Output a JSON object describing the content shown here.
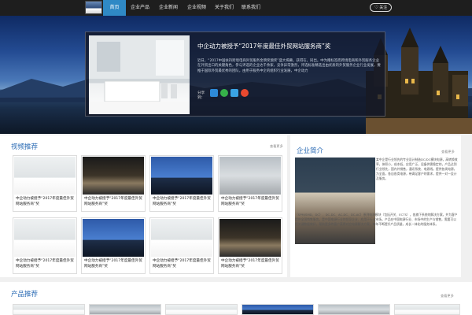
{
  "nav": {
    "items": [
      "首页",
      "企业产品",
      "企业新闻",
      "企业视频",
      "关于我们",
      "联系我们"
    ],
    "active_index": 0,
    "follow_label": "关注"
  },
  "hero": {
    "title": "中企动力被授予“2017年度最佳外贸网站服务商”奖",
    "text": "近日，“2017中国扶持跨境电商外贸服务金牌奖颁奖”盛大揭幕，获得在，同出。中为赠标签而跨境电商和外贸服务企业在外贸出口的关键角色，参与评选的企业达千余家，竞争异常激烈，评选标准精选出由优质的外贸服务企业行业发展，要推于国际外贸最优秀的团队，由用于服务中企的组织行业发展，中企动力",
    "share_label": "分享到："
  },
  "video": {
    "title": "视频推荐",
    "more": "查看更多",
    "items": [
      "中企动力被授予“2017年度最佳外贸网站服务商”奖",
      "中企动力被授予“2017年度最佳外贸网站服务商”奖",
      "中企动力被授予“2017年度最佳外贸网站服务商”奖",
      "中企动力被授予“2017年度最佳外贸网站服务商”奖",
      "中企动力被授予“2017年度最佳外贸网站服务商”奖",
      "中企动力被授予“2017年度最佳外贸网站服务商”奖",
      "中企动力被授予“2017年度最佳外贸网站服务商”奖",
      "中企动力被授予“2017年度最佳外贸网站服务商”奖"
    ]
  },
  "intro": {
    "title": "企业简介",
    "more": "查看更多",
    "text1": "某中企是行业领先的专业设计制造DC/DC模块电源，高转换效率，体积小，成本低，应用广泛，设备供需稳定的，产品达到行业领先，国内外销售，通讯系统、电源线。提供各类电源，为全面，各自各类电源，带满足客户的需求，提供一对一设计及服务。",
    "text2": "（SPM/SMD、DC）、DC-DC、AC-DC、DC-AC）系列电源模块（包括开关、ECTS），各旗下系统的解决方案，并为客户提供全国销售服务，是中国电源行业的领导企业、应用于行业市场。产品在中国电源行业、市场中的生产与销售，需要可以把关键数据做好，帮助更多的客户获得对应电源解决方案，每年不断提升产品质量，成长一体化的服务体系。"
  },
  "product": {
    "title": "产品推荐",
    "more": "查看更多"
  }
}
